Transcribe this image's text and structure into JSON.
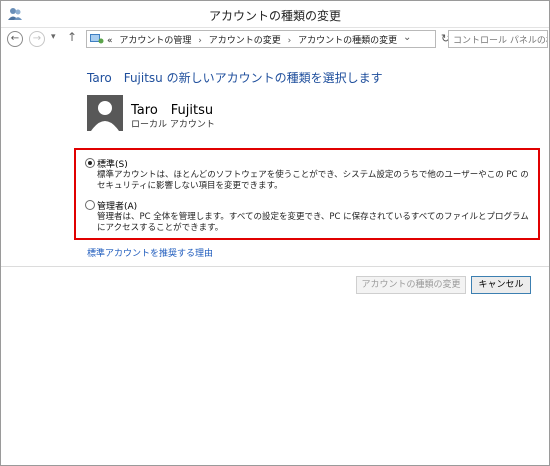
{
  "window": {
    "title": "アカウントの種類の変更",
    "icon": "user-accounts-icon"
  },
  "nav": {
    "back_icon": "back-arrow-icon",
    "forward_icon": "forward-arrow-icon",
    "recent_icon": "chevron-down-icon",
    "up_icon": "up-arrow-icon",
    "address_prefix": "«",
    "breadcrumbs": [
      "アカウントの管理",
      "アカウントの変更",
      "アカウントの種類の変更"
    ],
    "refresh_icon": "refresh-icon",
    "search_placeholder": "コントロール パネルの検索"
  },
  "main": {
    "heading": "Taro　Fujitsu の新しいアカウントの種類を選択します",
    "user": {
      "name": "Taro　Fujitsu",
      "account_type": "ローカル アカウント"
    },
    "options": [
      {
        "label": "標準(S)",
        "description": "標準アカウントは、ほとんどのソフトウェアを使うことができ、システム設定のうちで他のユーザーやこの PC のセキュリティに影響しない項目を変更できます。",
        "selected": true
      },
      {
        "label": "管理者(A)",
        "description": "管理者は、PC 全体を管理します。すべての設定を変更でき、PC に保存されているすべてのファイルとプログラムにアクセスすることができます。",
        "selected": false
      }
    ],
    "recommend_link": "標準アカウントを推奨する理由"
  },
  "buttons": {
    "change_type": "アカウントの種類の変更",
    "cancel": "キャンセル"
  },
  "colors": {
    "heading": "#1e4e9c",
    "link": "#1e5bbd",
    "highlight": "#e00000"
  }
}
